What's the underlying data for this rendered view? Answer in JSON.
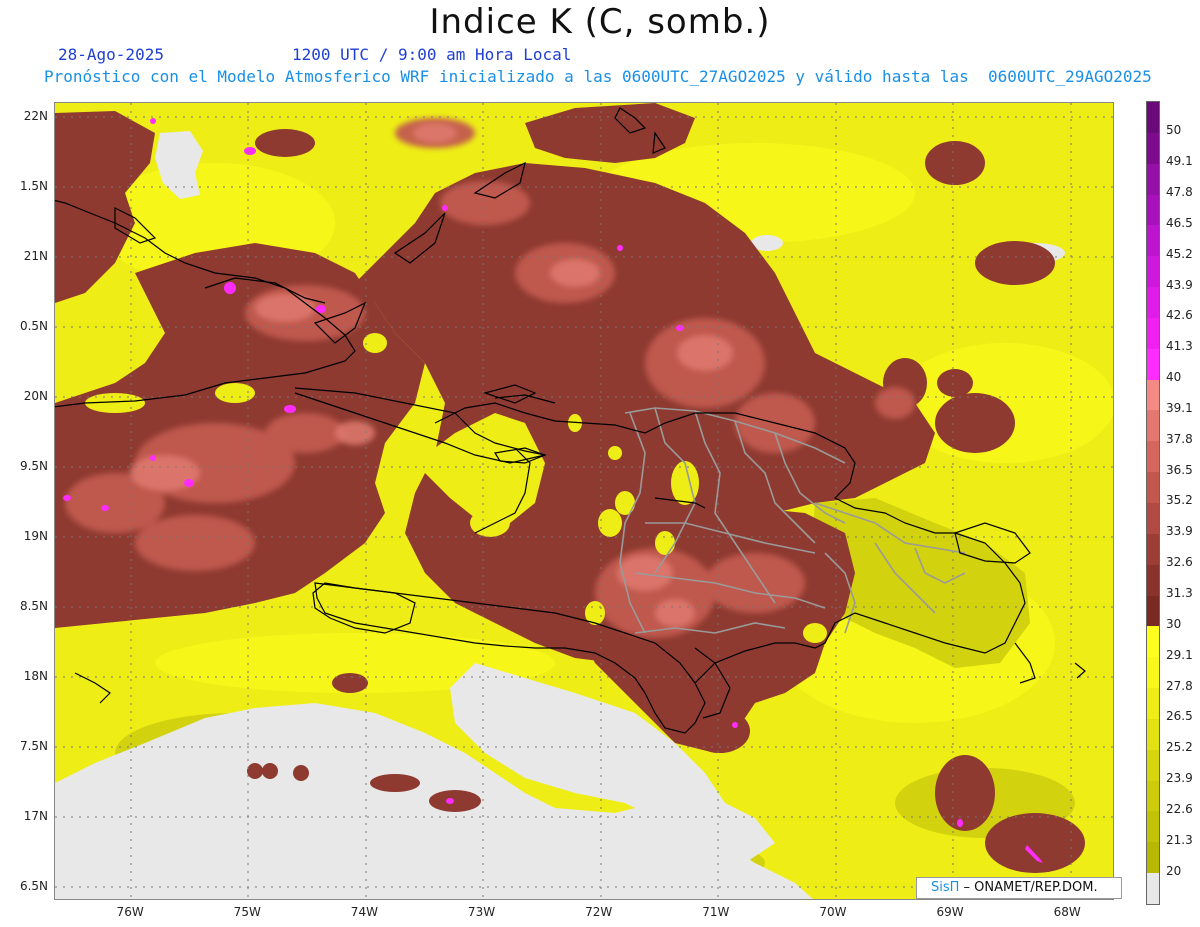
{
  "header": {
    "title": "Indice K (C, somb.)",
    "date": "28-Ago-2025",
    "valid_time": "1200 UTC / 9:00 am Hora Local",
    "model_line": "Pronóstico con el Modelo Atmosferico WRF inicializado a las 0600UTC_27AGO2025 y válido hasta las  0600UTC_29AGO2025"
  },
  "map": {
    "lat_range": [
      16.4,
      22.1
    ],
    "lon_range": [
      -76.65,
      -67.6
    ],
    "lat_labels": [
      "22N",
      "1.5N",
      "21N",
      "0.5N",
      "20N",
      "9.5N",
      "19N",
      "8.5N",
      "18N",
      "7.5N",
      "17N",
      "6.5N"
    ],
    "lat_values": [
      22.0,
      21.5,
      21.0,
      20.5,
      20.0,
      19.5,
      19.0,
      18.5,
      18.0,
      17.5,
      17.0,
      16.5
    ],
    "lon_labels": [
      "76W",
      "75W",
      "74W",
      "73W",
      "72W",
      "71W",
      "70W",
      "69W",
      "68W"
    ],
    "lon_values": [
      -76,
      -75,
      -74,
      -73,
      -72,
      -71,
      -70,
      -69,
      -68
    ],
    "colors": {
      "below_20": "#e8e8e8",
      "coastline": "#000000",
      "provinces": "#9a9a9a",
      "grid": "#777777"
    }
  },
  "colorbar": {
    "labels": [
      "50",
      "49.1",
      "47.8",
      "46.5",
      "45.2",
      "43.9",
      "42.6",
      "41.3",
      "40",
      "39.1",
      "37.8",
      "36.5",
      "35.2",
      "33.9",
      "32.6",
      "31.3",
      "30",
      "29.1",
      "27.8",
      "26.5",
      "25.2",
      "23.9",
      "22.6",
      "21.3",
      "20"
    ],
    "colors": [
      "#6a0a78",
      "#7e0a8e",
      "#9410a6",
      "#a810bc",
      "#bc14cf",
      "#cf18dd",
      "#e01ce8",
      "#f020f0",
      "#ff2cff",
      "#f48a84",
      "#e47870",
      "#d4665e",
      "#c2574e",
      "#b04a42",
      "#9c3e36",
      "#8a332c",
      "#7a2a22",
      "#ffff1e",
      "#f8f81a",
      "#eeee16",
      "#e2e212",
      "#d6d60e",
      "#cccc0a",
      "#c2c206",
      "#b8b802",
      "#e8e8e8"
    ]
  },
  "credit": {
    "brand": "SisΠ",
    "org": " – ONAMET/REP.DOM."
  }
}
